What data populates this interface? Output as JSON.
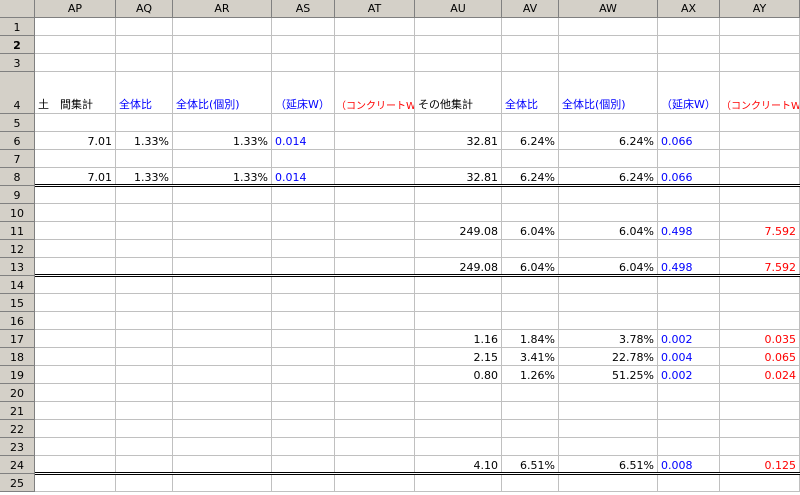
{
  "columns": [
    "AP",
    "AQ",
    "AR",
    "AS",
    "AT",
    "AU",
    "AV",
    "AW",
    "AX",
    "AY"
  ],
  "rows": [
    "1",
    "2",
    "3",
    "4",
    "5",
    "6",
    "7",
    "8",
    "9",
    "10",
    "11",
    "12",
    "13",
    "14",
    "15",
    "16",
    "17",
    "18",
    "19",
    "20",
    "21",
    "22",
    "23",
    "24",
    "25"
  ],
  "headers": {
    "AP": "土　間集計",
    "AQ": "全体比",
    "AR": "全体比(個別)",
    "AS": "（延床W）",
    "AT": "（コンクリートW）",
    "AU": "その他集計",
    "AV": "全体比",
    "AW": "全体比(個別)",
    "AX": "（延床W）",
    "AY": "（コンクリートW）"
  },
  "cells": {
    "r6": {
      "AP": "7.01",
      "AQ": "1.33%",
      "AR": "1.33%",
      "AS": "0.014",
      "AU": "32.81",
      "AV": "6.24%",
      "AW": "6.24%",
      "AX": "0.066"
    },
    "r8": {
      "AP": "7.01",
      "AQ": "1.33%",
      "AR": "1.33%",
      "AS": "0.014",
      "AU": "32.81",
      "AV": "6.24%",
      "AW": "6.24%",
      "AX": "0.066"
    },
    "r11": {
      "AU": "249.08",
      "AV": "6.04%",
      "AW": "6.04%",
      "AX": "0.498",
      "AY": "7.592"
    },
    "r13": {
      "AU": "249.08",
      "AV": "6.04%",
      "AW": "6.04%",
      "AX": "0.498",
      "AY": "7.592"
    },
    "r17": {
      "AU": "1.16",
      "AV": "1.84%",
      "AW": "3.78%",
      "AX": "0.002",
      "AY": "0.035"
    },
    "r18": {
      "AU": "2.15",
      "AV": "3.41%",
      "AW": "22.78%",
      "AX": "0.004",
      "AY": "0.065"
    },
    "r19": {
      "AU": "0.80",
      "AV": "1.26%",
      "AW": "51.25%",
      "AX": "0.002",
      "AY": "0.024"
    },
    "r24": {
      "AU": "4.10",
      "AV": "6.51%",
      "AW": "6.51%",
      "AX": "0.008",
      "AY": "0.125"
    }
  },
  "selected_row": "2",
  "colors": {
    "blue": "#0000ff",
    "red": "#ff0000",
    "header_bg": "#d4d0c8",
    "grid": "#c0c0c0"
  }
}
